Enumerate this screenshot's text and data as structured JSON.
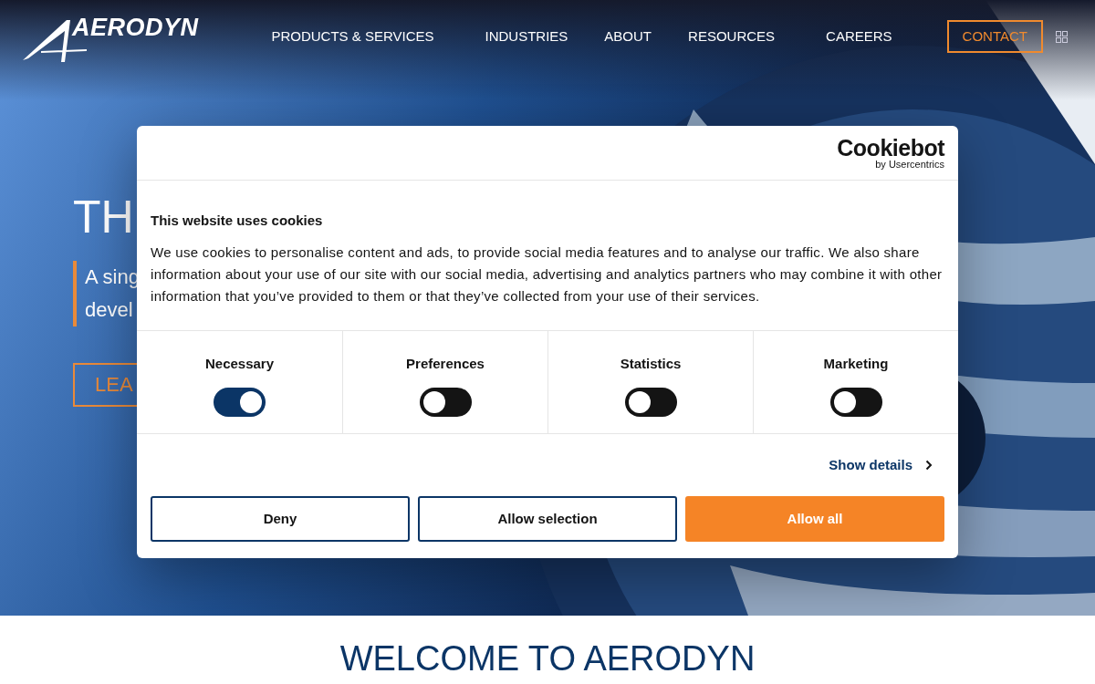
{
  "header": {
    "logo": "AERODYN",
    "nav": [
      {
        "label": "PRODUCTS & SERVICES",
        "kind": "link"
      },
      {
        "label": "INDUSTRIES",
        "kind": "link"
      },
      {
        "label": "ABOUT",
        "kind": "link"
      },
      {
        "label": "RESOURCES",
        "kind": "link"
      },
      {
        "label": "CAREERS",
        "kind": "link"
      },
      {
        "label": "CONTACT",
        "kind": "outlined"
      }
    ]
  },
  "hero": {
    "title": "TH",
    "subtitle_lines": [
      "A sing",
      "devel"
    ],
    "button": "LEA"
  },
  "cookie_dialog": {
    "brand": "Cookiebot",
    "brand_sub": "by Usercentrics",
    "title": "This website uses cookies",
    "text": "We use cookies to personalise content and ads, to provide social media features and to analyse our traffic. We also share information about your use of our site with our social media, advertising and analytics partners who may combine it with other information that you’ve provided to them or that they’ve collected from your use of their services.",
    "categories": [
      {
        "label": "Necessary",
        "on": true
      },
      {
        "label": "Preferences",
        "on": false
      },
      {
        "label": "Statistics",
        "on": false
      },
      {
        "label": "Marketing",
        "on": false
      }
    ],
    "details_link": "Show details",
    "buttons": [
      {
        "label": "Deny",
        "kind": "outline"
      },
      {
        "label": "Allow selection",
        "kind": "outline"
      },
      {
        "label": "Allow all",
        "kind": "primary"
      }
    ]
  },
  "welcome": {
    "heading": "WELCOME TO AERODYN"
  }
}
